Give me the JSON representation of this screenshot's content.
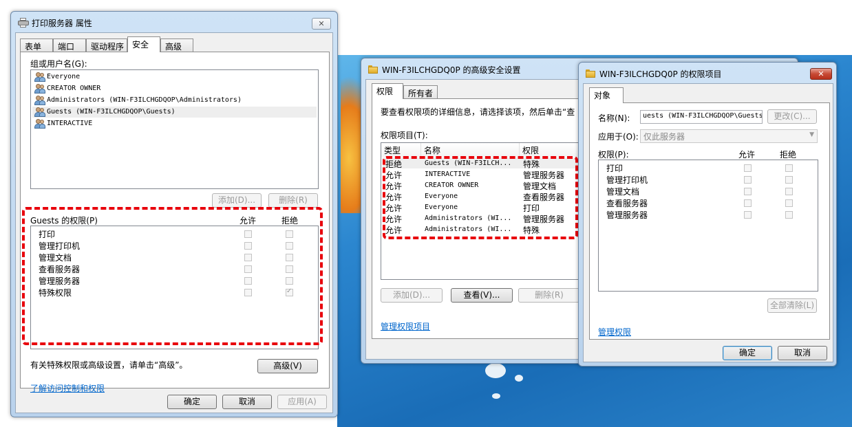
{
  "props_window": {
    "title": "打印服务器 属性",
    "close": "✕",
    "tabs": [
      "表单",
      "端口",
      "驱动程序",
      "安全",
      "高级"
    ],
    "group_label": "组或用户名(G):",
    "users": [
      "Everyone",
      "CREATOR OWNER",
      "Administrators (WIN-F3ILCHGDQOP\\Administrators)",
      "Guests (WIN-F3ILCHGDQOP\\Guests)",
      "INTERACTIVE"
    ],
    "add_button": "添加(D)...",
    "remove_button": "删除(R)",
    "perm_header": "Guests 的权限(P)",
    "allow_header": "允许",
    "deny_header": "拒绝",
    "permissions": [
      "打印",
      "管理打印机",
      "管理文档",
      "查看服务器",
      "管理服务器",
      "特殊权限"
    ],
    "special_note": "有关特殊权限或高级设置，请单击“高级”。",
    "advanced_button": "高级(V)",
    "learn_link": "了解访问控制和权限",
    "ok": "确定",
    "cancel": "取消",
    "apply": "应用(A)"
  },
  "adv_window": {
    "title": "WIN-F3ILCHGDQ0P 的高级安全设置",
    "tabs": [
      "权限",
      "所有者"
    ],
    "info_text": "要查看权限项的详细信息，请选择该项，然后单击“查",
    "entries_label": "权限项目(T):",
    "columns": [
      "类型",
      "名称",
      "权限"
    ],
    "entries": [
      {
        "type": "拒绝",
        "name": "Guests (WIN-F3ILCH...",
        "perm": "特殊"
      },
      {
        "type": "允许",
        "name": "INTERACTIVE",
        "perm": "管理服务器"
      },
      {
        "type": "允许",
        "name": "CREATOR OWNER",
        "perm": "管理文档"
      },
      {
        "type": "允许",
        "name": "Everyone",
        "perm": "查看服务器"
      },
      {
        "type": "允许",
        "name": "Everyone",
        "perm": "打印"
      },
      {
        "type": "允许",
        "name": "Administrators (WI...",
        "perm": "管理服务器"
      },
      {
        "type": "允许",
        "name": "Administrators (WI...",
        "perm": "特殊"
      }
    ],
    "add_button": "添加(D)...",
    "view_button": "查看(V)...",
    "remove_button": "删除(R)",
    "manage_link": "管理权限项目"
  },
  "entry_window": {
    "title": "WIN-F3ILCHGDQ0P 的权限项目",
    "tab": "对象",
    "name_label": "名称(N):",
    "name_value": "uests (WIN-F3ILCHGDQOP\\Guests)",
    "change_button": "更改(C)...",
    "apply_to_label": "应用于(O):",
    "apply_to_value": "仅此服务器",
    "perm_label": "权限(P):",
    "allow_header": "允许",
    "deny_header": "拒绝",
    "permissions": [
      "打印",
      "管理打印机",
      "管理文档",
      "查看服务器",
      "管理服务器"
    ],
    "clear_all_button": "全部清除(L)",
    "manage_link": "管理权限",
    "ok": "确定",
    "cancel": "取消"
  },
  "colors": {
    "highlight": "#e8000b",
    "link": "#0066cc",
    "desktop": "#2b86cf"
  }
}
